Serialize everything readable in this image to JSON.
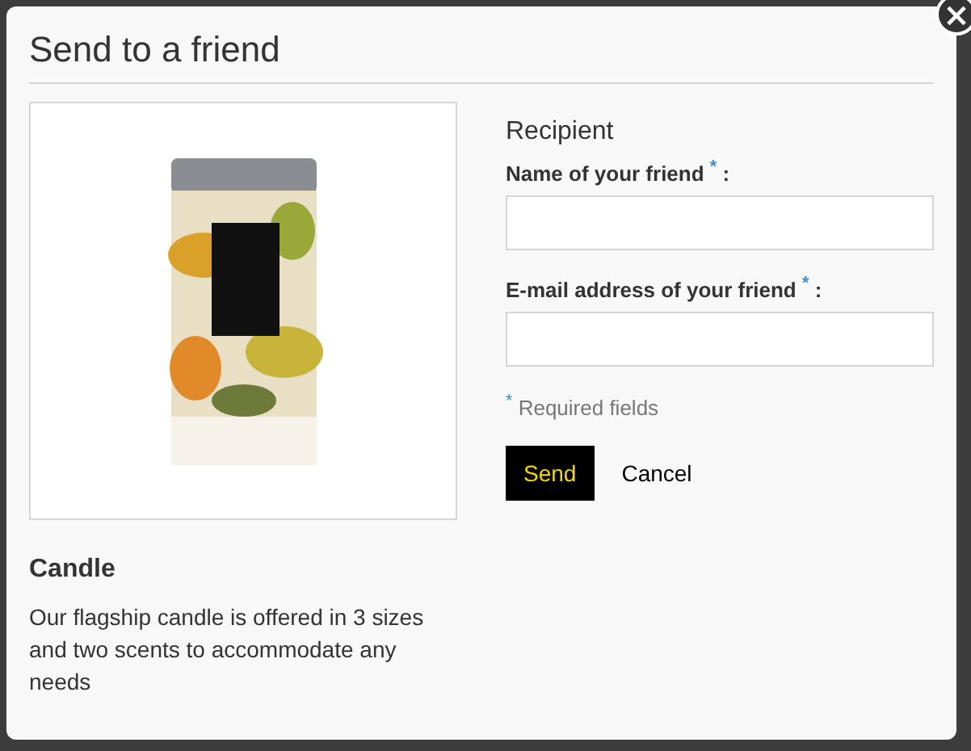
{
  "dialog": {
    "title": "Send to a friend",
    "close_icon": "×"
  },
  "product": {
    "name": "Candle",
    "description": "Our flagship candle is offered in 3 sizes and two scents to accommodate any needs"
  },
  "form": {
    "heading": "Recipient",
    "fields": [
      {
        "label": "Name of your friend $^{*}$ :"
      },
      {
        "label": "E-mail address of your friend $^{*}$ :"
      }
    ],
    "required_note": "$^{*}$ Required fields",
    "buttons": [
      {
        "label": "Send",
        "kind": "primary"
      },
      {
        "label": "Cancel",
        "kind": "link"
      }
    ]
  }
}
